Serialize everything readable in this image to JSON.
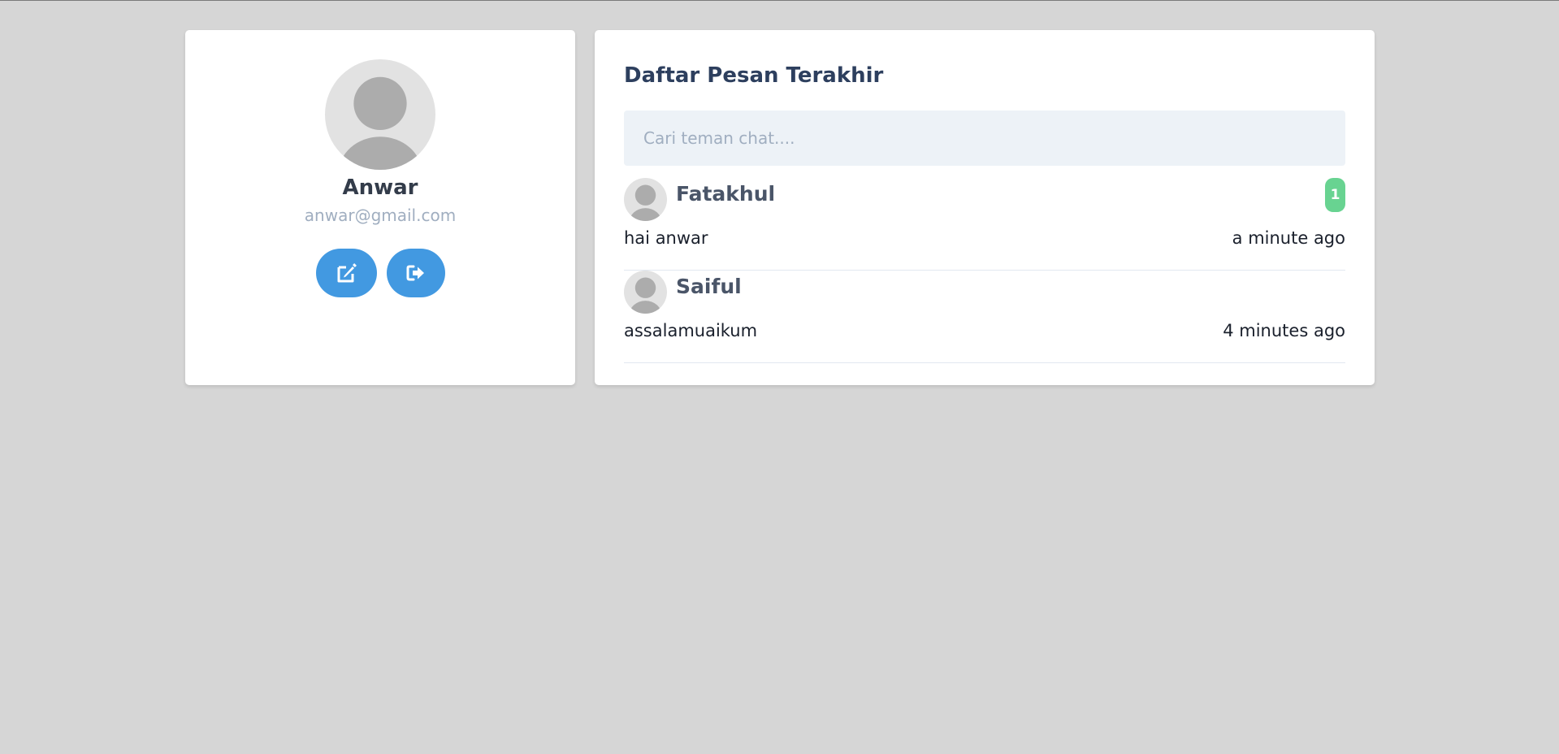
{
  "profile": {
    "name": "Anwar",
    "email": "anwar@gmail.com",
    "actions": [
      {
        "icon": "edit-icon"
      },
      {
        "icon": "sign-out-icon"
      }
    ]
  },
  "messages": {
    "title": "Daftar Pesan Terakhir",
    "search": {
      "placeholder": "Cari teman chat....",
      "value": ""
    },
    "items": [
      {
        "name": "Fatakhul",
        "last_message": "hai anwar",
        "time": "a minute ago",
        "unread": "1"
      },
      {
        "name": "Saiful",
        "last_message": "assalamuaikum",
        "time": "4 minutes ago",
        "unread": ""
      }
    ]
  },
  "colors": {
    "page_background": "#d6d6d6",
    "card_background": "#ffffff",
    "accent": "#4299e1",
    "badge": "#68d391",
    "input_background": "#edf2f7",
    "title_text": "#2d3f5e",
    "muted_text": "#a0aec0"
  }
}
